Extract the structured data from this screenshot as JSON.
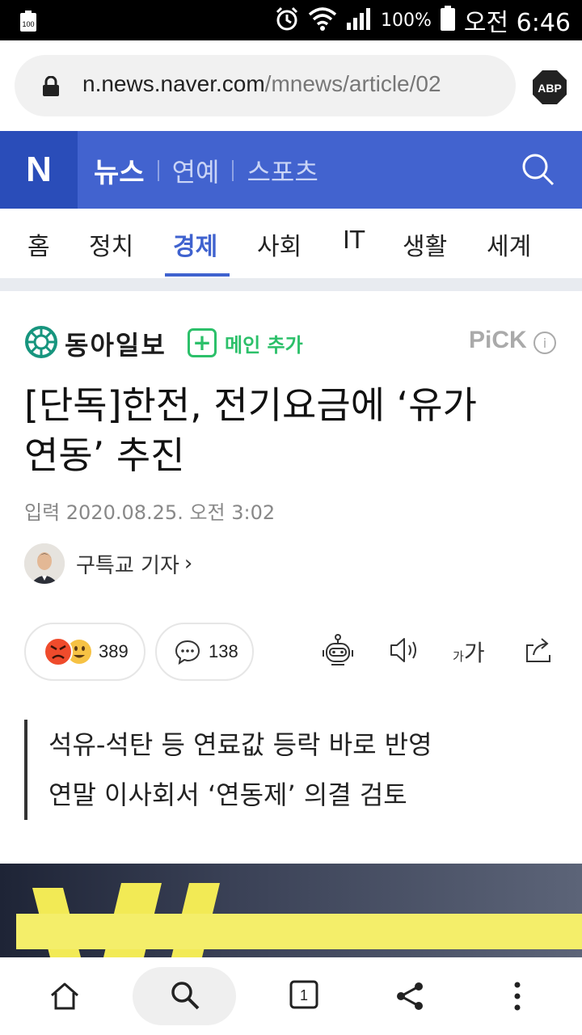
{
  "status_bar": {
    "battery_badge": "100",
    "battery_percent": "100%",
    "time": "오전 6:46",
    "icons": [
      "alarm-icon",
      "wifi-icon",
      "signal-icon",
      "battery-icon"
    ]
  },
  "browser": {
    "url_host": "n.news.naver.com",
    "url_path": "/mnews/article/02",
    "adblock_label": "ABP"
  },
  "naver_header": {
    "logo": "N",
    "sections": [
      "뉴스",
      "연예",
      "스포츠"
    ],
    "colors": {
      "header_bg": "#4263cf",
      "logo_bg": "#2a4db9"
    }
  },
  "categories": {
    "items": [
      "홈",
      "정치",
      "경제",
      "사회",
      "IT",
      "생활",
      "세계"
    ],
    "active": "경제",
    "active_color": "#3f62cf"
  },
  "article": {
    "press_name": "동아일보",
    "main_add_label": "메인 추가",
    "pick_label": "PiCK",
    "headline_line1": "[단독]한전, 전기요금에 ‘유가",
    "headline_line2": "연동’ 추진",
    "date": "입력 2020.08.25. 오전 3:02",
    "author": "구특교 기자",
    "reaction_count": "389",
    "comment_count": "138",
    "font_size_small": "가",
    "font_size_big": "가",
    "summary": [
      "석유-석탄 등 연료값 등락 바로 반영",
      "연말 이사회서 ‘연동제’ 의결 검토"
    ]
  },
  "bottom_nav": {
    "tab_count": "1",
    "icons": [
      "home-icon",
      "search-icon",
      "tabs-icon",
      "share-icon",
      "more-icon"
    ]
  }
}
